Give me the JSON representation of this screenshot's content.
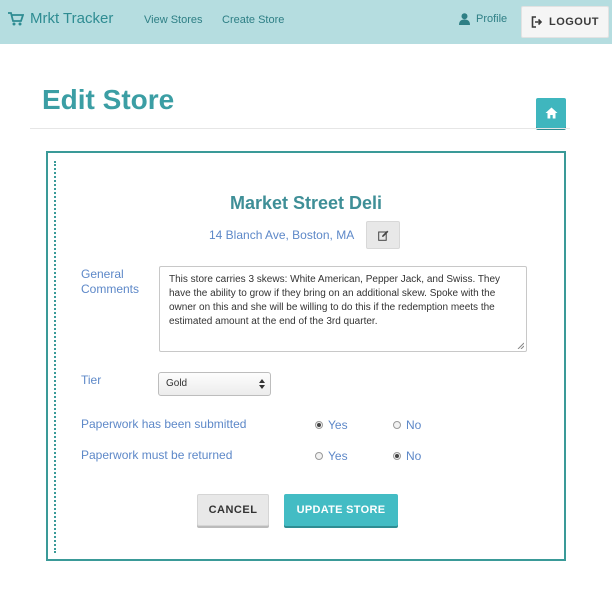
{
  "app": {
    "brand": "Mrkt Tracker"
  },
  "nav": {
    "view_stores": "View Stores",
    "create_store": "Create Store",
    "profile": "Profile",
    "logout": "LOGOUT"
  },
  "page": {
    "title": "Edit Store"
  },
  "store": {
    "name": "Market Street Deli",
    "address": "14 Blanch Ave, Boston, MA"
  },
  "form": {
    "comments_label": "General Comments",
    "comments_value": "This store carries 3 skews: White American, Pepper Jack, and Swiss. They have the ability to grow if they bring on an additional skew. Spoke with the owner on this and she will be willing to do this if the redemption meets the estimated amount at the end of the 3rd quarter.",
    "tier_label": "Tier",
    "tier_value": "Gold",
    "paperwork_submitted_label": "Paperwork has been submitted",
    "paperwork_submitted_yes": "Yes",
    "paperwork_submitted_no": "No",
    "paperwork_submitted_selected": "Yes",
    "paperwork_returned_label": "Paperwork must be returned",
    "paperwork_returned_yes": "Yes",
    "paperwork_returned_no": "No",
    "paperwork_returned_selected": "No",
    "cancel": "CANCEL",
    "update": "UPDATE STORE"
  },
  "icons": {
    "brand": "cart-icon",
    "profile": "user-icon",
    "logout": "sign-out-icon",
    "home": "home-icon",
    "edit": "edit-icon"
  },
  "colors": {
    "navbar": "#b5dde0",
    "accent": "#3fb6be",
    "title": "#3b9ea4",
    "label": "#5d88c8",
    "card_border": "#3a9a98"
  }
}
